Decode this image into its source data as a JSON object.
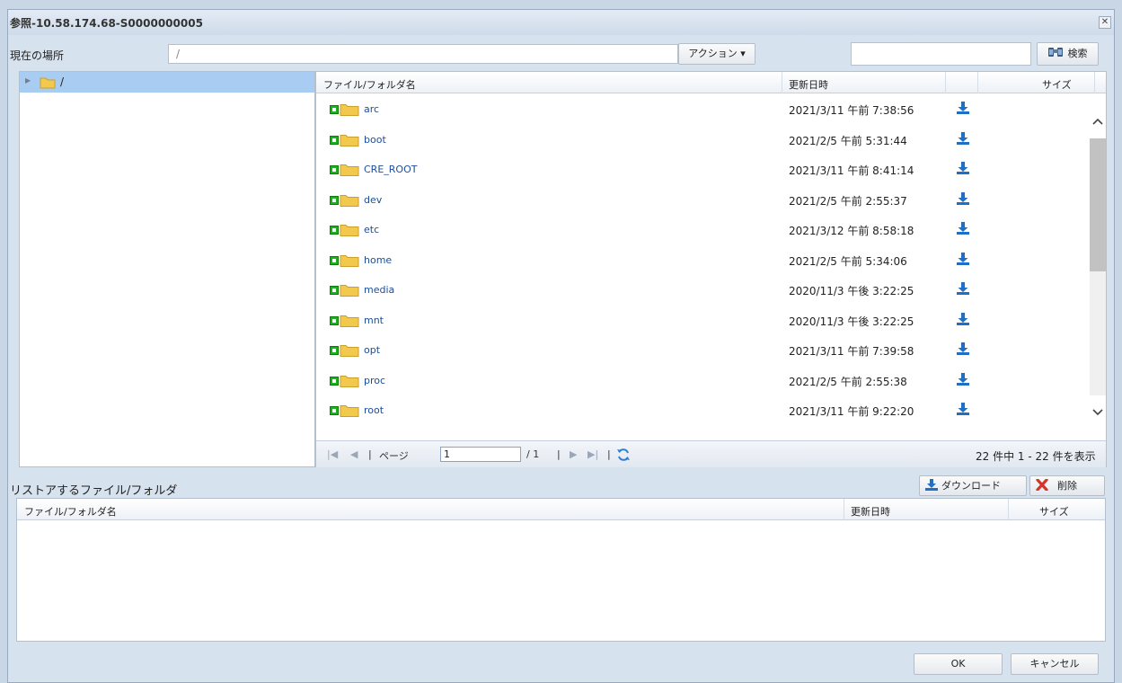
{
  "window": {
    "title": "参照-10.58.174.68-S0000000005",
    "close_glyph": "✕"
  },
  "location": {
    "label": "現在の場所",
    "value": "/"
  },
  "toolbar": {
    "action_label": "アクション ▾",
    "search_label": "検索",
    "search_value": ""
  },
  "tree": {
    "root_label": "/"
  },
  "grid": {
    "columns": {
      "name": "ファイル/フォルダ名",
      "date": "更新日時",
      "size": "サイズ"
    },
    "rows": [
      {
        "name": "arc",
        "date": "2021/3/11 午前 7:38:56"
      },
      {
        "name": "boot",
        "date": "2021/2/5 午前 5:31:44"
      },
      {
        "name": "CRE_ROOT",
        "date": "2021/3/11 午前 8:41:14"
      },
      {
        "name": "dev",
        "date": "2021/2/5 午前 2:55:37"
      },
      {
        "name": "etc",
        "date": "2021/3/12 午前 8:58:18"
      },
      {
        "name": "home",
        "date": "2021/2/5 午前 5:34:06"
      },
      {
        "name": "media",
        "date": "2020/11/3 午後 3:22:25"
      },
      {
        "name": "mnt",
        "date": "2020/11/3 午後 3:22:25"
      },
      {
        "name": "opt",
        "date": "2021/3/11 午前 7:39:58"
      },
      {
        "name": "proc",
        "date": "2021/2/5 午前 2:55:38"
      },
      {
        "name": "root",
        "date": "2021/3/11 午前 9:22:20"
      }
    ]
  },
  "pager": {
    "first_glyph": "|◀",
    "prev_glyph": "◀",
    "page_label": "ページ",
    "page_value": "1",
    "page_total": "/ 1",
    "next_glyph": "▶",
    "last_glyph": "▶|",
    "summary": "22 件中 1 - 22 件を表示"
  },
  "restore": {
    "label": "リストアするファイル/フォルダ",
    "download_label": "ダウンロード",
    "delete_label": "削除",
    "columns": {
      "name": "ファイル/フォルダ名",
      "date": "更新日時",
      "size": "サイズ"
    }
  },
  "footer": {
    "ok_label": "OK",
    "cancel_label": "キャンセル"
  },
  "colors": {
    "selection": "#a8ccf2",
    "link": "#1c4e99",
    "folder": "#f2c94c",
    "status_green": "#1bb31b",
    "download_blue": "#1f6fc4",
    "delete_red": "#d6332b"
  }
}
